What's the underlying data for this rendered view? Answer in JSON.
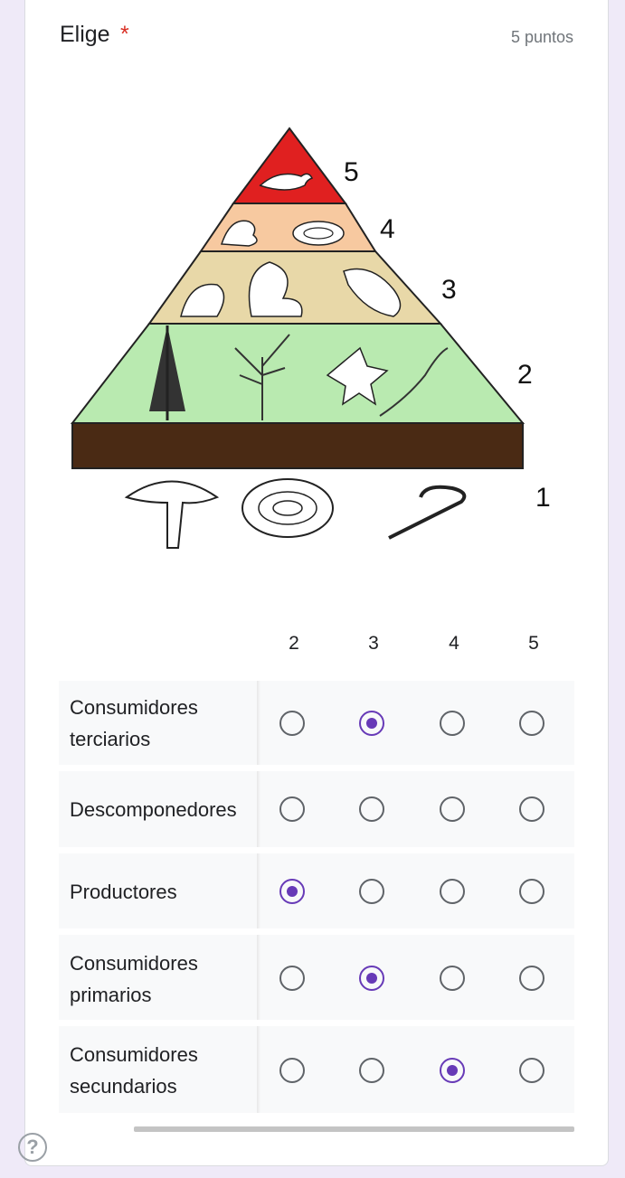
{
  "question": {
    "title": "Elige",
    "required_mark": "*",
    "points": "5 puntos"
  },
  "figure": {
    "level_labels": [
      "5",
      "4",
      "3",
      "2",
      "1"
    ],
    "colors": {
      "top": "#e02020",
      "level4": "#f7c9a0",
      "level3": "#e8d8a8",
      "level2": "#b9eab0",
      "soil": "#4a2a14"
    }
  },
  "grid": {
    "columns": [
      "2",
      "3",
      "4",
      "5"
    ],
    "rows": [
      {
        "label": "Consumidores terciarios",
        "selected": "3"
      },
      {
        "label": "Descomponedores",
        "selected": null
      },
      {
        "label": "Productores",
        "selected": "2"
      },
      {
        "label": "Consumidores primarios",
        "selected": "3"
      },
      {
        "label": "Consumidores secundarios",
        "selected": "4"
      }
    ]
  },
  "help": {
    "icon": "help-icon",
    "glyph": "?"
  },
  "accent": "#673ab7"
}
